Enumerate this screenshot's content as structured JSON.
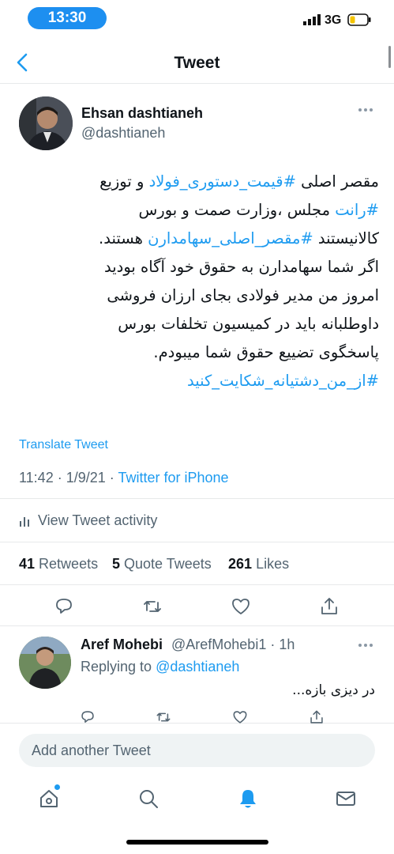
{
  "status_bar": {
    "time": "13:30",
    "network": "3G",
    "signal_icon": "signal-bars-icon",
    "battery_icon": "battery-low-icon",
    "battery_color": "#f5c400",
    "time_pill_color": "#1d8ff0"
  },
  "nav": {
    "title": "Tweet",
    "back_icon": "chevron-left-icon"
  },
  "tweet": {
    "author_name": "Ehsan dashtianeh",
    "author_handle": "@dashtianeh",
    "lines": [
      [
        {
          "text": "مقصر اصلی ",
          "tag": false
        },
        {
          "text": "#قیمت_دستوری_فولاد",
          "tag": true
        },
        {
          "text": " و توزیع",
          "tag": false
        }
      ],
      [
        {
          "text": "#رانت",
          "tag": true
        },
        {
          "text": " مجلس ،وزارت صمت و بورس",
          "tag": false
        }
      ],
      [
        {
          "text": "کالانیستند ",
          "tag": false
        },
        {
          "text": "#مقصر_اصلی_سهامدارن",
          "tag": true
        },
        {
          "text": " هستند.",
          "tag": false
        }
      ],
      [
        {
          "text": "اگر شما سهامدارن به حقوق خود آگاه بودید",
          "tag": false
        }
      ],
      [
        {
          "text": "امروز من مدیر فولادی بجای  ارزان فروشی",
          "tag": false
        }
      ],
      [
        {
          "text": "داوطلبانه باید در کمیسیون تخلفات بورس",
          "tag": false
        }
      ],
      [
        {
          "text": "پاسخگوی تضییع حقوق شما میبودم.",
          "tag": false
        }
      ],
      [
        {
          "text": "#از_من_دشتیانه_شکایت_کنید",
          "tag": true
        }
      ]
    ],
    "translate_label": "Translate Tweet",
    "time": "11:42",
    "date": "1/9/21",
    "source": "Twitter for iPhone",
    "activity_label": "View Tweet activity",
    "retweets_count": "41",
    "retweets_label": "Retweets",
    "quotes_count": "5",
    "quotes_label": "Quote Tweets",
    "likes_count": "261",
    "likes_label": "Likes",
    "actions": [
      "reply-icon",
      "retweet-icon",
      "like-icon",
      "share-icon"
    ]
  },
  "reply": {
    "name": "Aref Mohebi",
    "handle": "@ArefMohebi1 · 1h",
    "replying_prefix": "Replying to ",
    "replying_to": "@dashtianeh",
    "text": "در دیزی بازه..."
  },
  "composer": {
    "placeholder": "Add another Tweet"
  },
  "tab_bar": {
    "items": [
      "home-icon",
      "search-icon",
      "notifications-icon",
      "messages-icon"
    ],
    "active": "notifications-icon",
    "accent": "#1d9bf0"
  }
}
